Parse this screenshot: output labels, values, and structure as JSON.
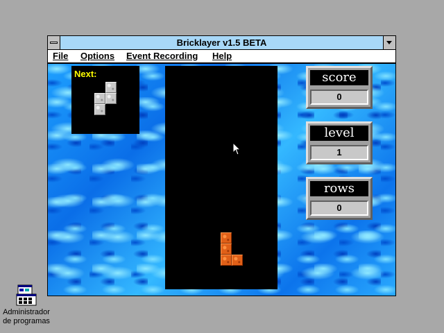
{
  "window": {
    "title": "Bricklayer v1.5 BETA"
  },
  "menu": {
    "file": "File",
    "options": "Options",
    "event_recording": "Event Recording",
    "help": "Help"
  },
  "next_preview": {
    "label": "Next:",
    "piece_color": "#c8c8c8"
  },
  "board": {
    "falling_piece_color": "#e06018"
  },
  "stats": {
    "score_label": "score",
    "score_value": "0",
    "level_label": "level",
    "level_value": "1",
    "rows_label": "rows",
    "rows_value": "0"
  },
  "desktop": {
    "icon_name": "program-manager-icon",
    "icon_label_line1": "Administrador",
    "icon_label_line2": "de programas"
  }
}
